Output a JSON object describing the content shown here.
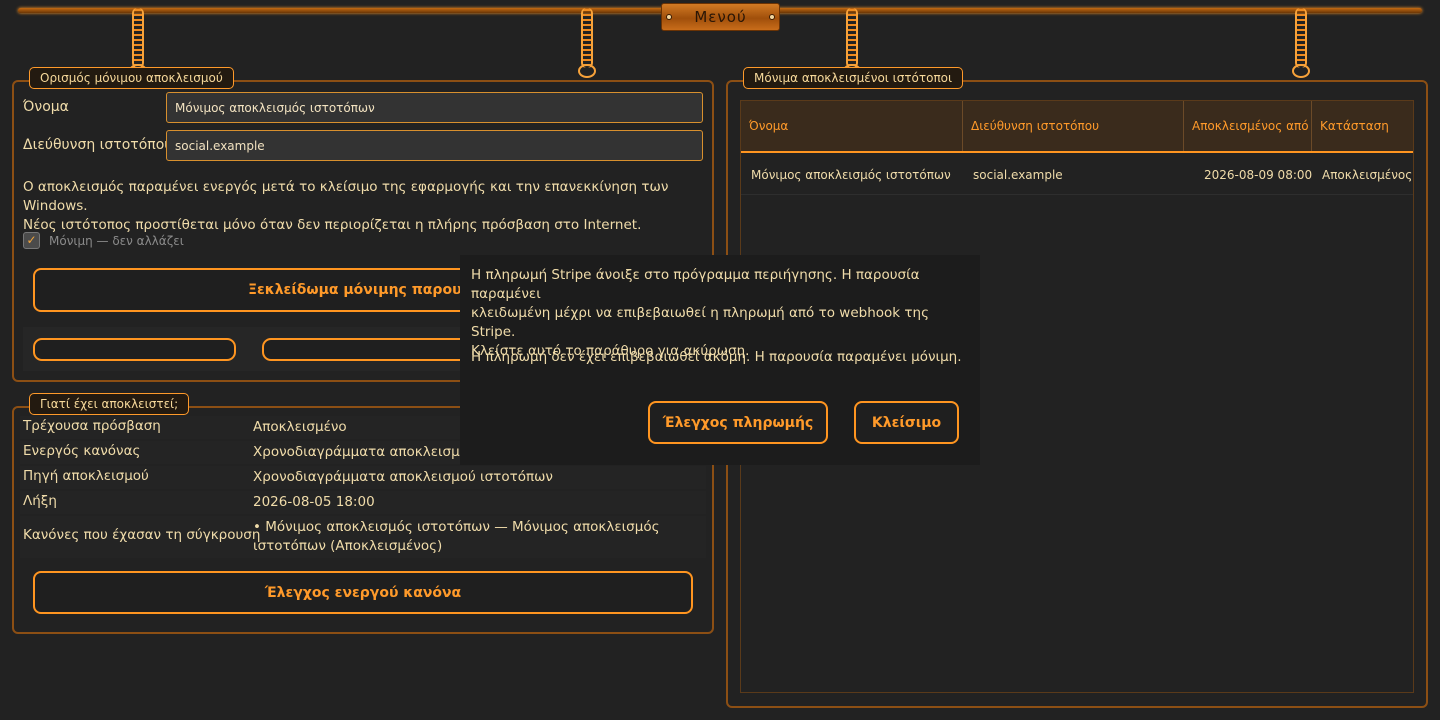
{
  "topbar": {
    "menu_label": "Μενού"
  },
  "rule_panel": {
    "title": "Ορισμός μόνιμου αποκλεισμού",
    "name_label": "Όνομα",
    "name_value": "Μόνιμος αποκλεισμός ιστοτόπων",
    "site_label": "Διεύθυνση ιστοτόπου",
    "site_value": "social.example",
    "description_line1": "Ο αποκλεισμός παραμένει ενεργός μετά το κλείσιμο της εφαρμογής και την επανεκκίνηση των Windows.",
    "description_line2": "Νέος ιστότοπος προστίθεται μόνο όταν δεν περιορίζεται η πλήρης πρόσβαση στο Internet.",
    "permanent_checkbox_label": "Μόνιμη — δεν αλλάζει",
    "unlock_button": "Ξεκλείδωμα μόνιμης παρουσί"
  },
  "why_panel": {
    "title": "Γιατί έχει αποκλειστεί;",
    "rows": [
      {
        "key": "Τρέχουσα πρόσβαση",
        "value": "Αποκλεισμένο"
      },
      {
        "key": "Ενεργός κανόνας",
        "value": "Χρονοδιαγράμματα αποκλεισμού"
      },
      {
        "key": "Πηγή αποκλεισμού",
        "value": "Χρονοδιαγράμματα αποκλεισμού ιστοτόπων"
      },
      {
        "key": "Λήξη",
        "value": "2026-08-05 18:00"
      }
    ],
    "lost_key": "Κανόνες που έχασαν τη σύγκρουση",
    "lost_value_line1": "• Μόνιμος αποκλεισμός ιστοτόπων — Μόνιμος αποκλεισμός",
    "lost_value_line2": "ιστοτόπων (Αποκλεισμένος)",
    "check_button": "Έλεγχος ενεργού κανόνα"
  },
  "blocked_panel": {
    "title": "Μόνιμα αποκλεισμένοι ιστότοποι",
    "columns": [
      "Όνομα",
      "Διεύθυνση ιστοτόπου",
      "Αποκλεισμένος από",
      "Κατάσταση"
    ],
    "rows": [
      [
        "Μόνιμος αποκλεισμός ιστοτόπων",
        "social.example",
        "2026-08-09 08:00",
        "Αποκλεισμένος"
      ]
    ]
  },
  "payment_dialog": {
    "line1": "Η πληρωμή Stripe άνοιξε στο πρόγραμμα περιήγησης. Η παρουσία παραμένει",
    "line2": "κλειδωμένη μέχρι να επιβεβαιωθεί η πληρωμή από το webhook της Stripe.",
    "line3": "Κλείστε αυτό το παράθυρο για ακύρωση.",
    "status": "Η πληρωμή δεν έχει επιβεβαιωθεί ακόμη. Η παρουσία παραμένει μόνιμη.",
    "check_payment_button": "Έλεγχος πληρωμής",
    "close_button": "Κλείσιμο"
  },
  "colors": {
    "accent": "#ff9520",
    "background": "#222222",
    "text": "#f0dcaa"
  }
}
